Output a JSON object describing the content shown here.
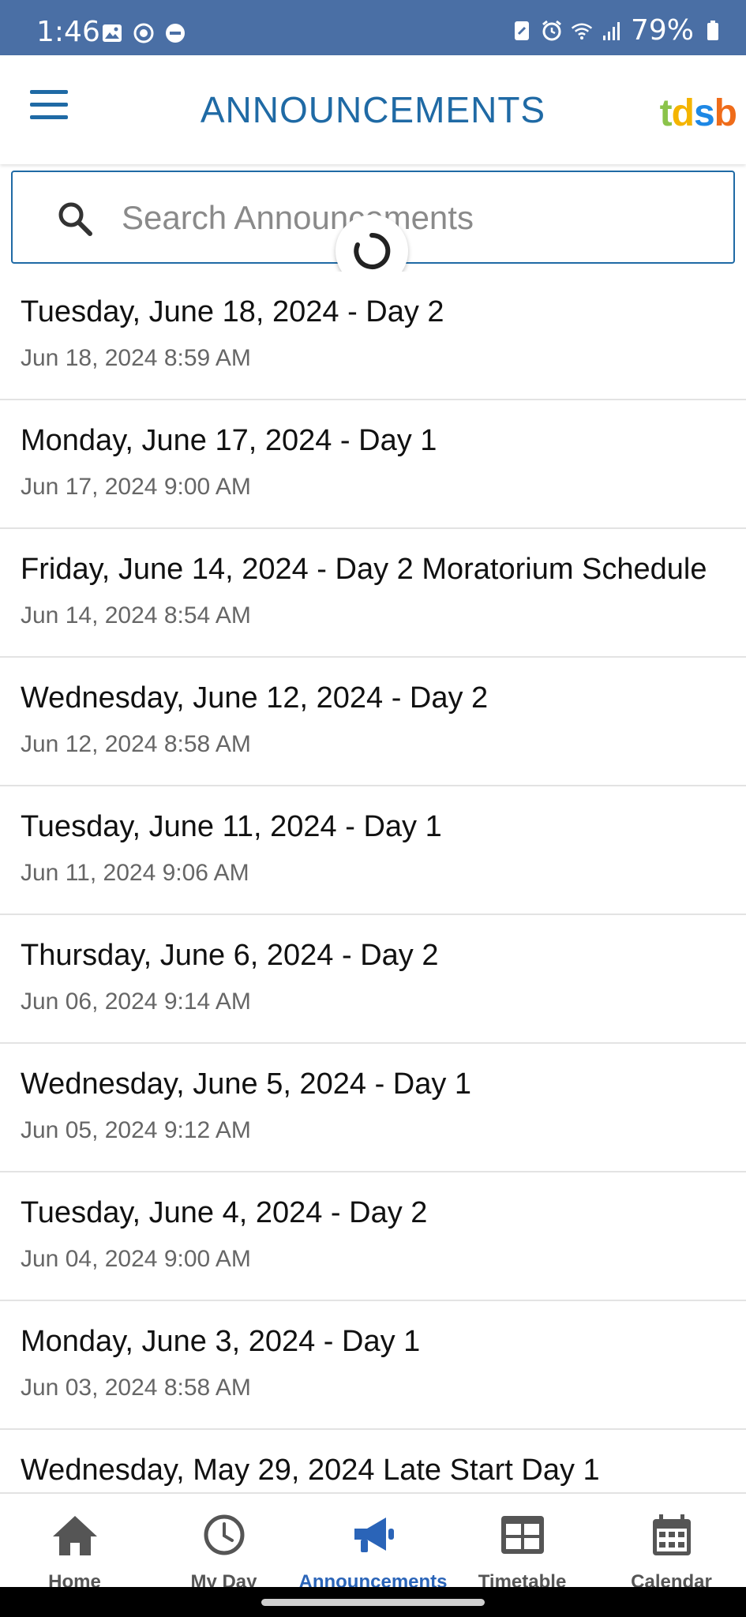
{
  "status_bar": {
    "time": "1:46",
    "battery": "79%",
    "left_icons": [
      "image-icon",
      "sync-icon",
      "do-not-disturb-icon"
    ],
    "right_icons": [
      "nfc-icon",
      "alarm-icon",
      "wifi-icon",
      "signal-icon",
      "battery-icon"
    ]
  },
  "header": {
    "title": "ANNOUNCEMENTS",
    "logo": {
      "t": "t",
      "d": "d",
      "s": "s",
      "b": "b"
    },
    "title_color": "#1f6aa5"
  },
  "search": {
    "placeholder": "Search Announcements",
    "value": ""
  },
  "announcements": [
    {
      "title": "Tuesday, June 18, 2024 - Day 2",
      "date": "Jun 18, 2024 8:59 AM"
    },
    {
      "title": "Monday, June 17, 2024 - Day 1",
      "date": "Jun 17, 2024 9:00 AM"
    },
    {
      "title": "Friday, June 14, 2024 - Day 2 Moratorium Schedule",
      "date": "Jun 14, 2024 8:54 AM"
    },
    {
      "title": "Wednesday, June 12, 2024 - Day 2",
      "date": "Jun 12, 2024 8:58 AM"
    },
    {
      "title": "Tuesday, June 11, 2024 - Day 1",
      "date": "Jun 11, 2024 9:06 AM"
    },
    {
      "title": "Thursday, June 6, 2024 - Day 2",
      "date": "Jun 06, 2024 9:14 AM"
    },
    {
      "title": "Wednesday, June 5, 2024 - Day 1",
      "date": "Jun 05, 2024 9:12 AM"
    },
    {
      "title": "Tuesday, June 4, 2024 - Day 2",
      "date": "Jun 04, 2024 9:00 AM"
    },
    {
      "title": "Monday, June 3, 2024 - Day 1",
      "date": "Jun 03, 2024 8:58 AM"
    },
    {
      "title": "Wednesday, May 29, 2024 Late Start Day 1",
      "date": ""
    }
  ],
  "bottom_nav": [
    {
      "label": "Home",
      "icon": "home-icon",
      "active": false
    },
    {
      "label": "My Day",
      "icon": "clock-icon",
      "active": false
    },
    {
      "label": "Announcements",
      "icon": "megaphone-icon",
      "active": true
    },
    {
      "label": "Timetable",
      "icon": "timetable-icon",
      "active": false
    },
    {
      "label": "Calendar",
      "icon": "calendar-icon",
      "active": false
    }
  ],
  "colors": {
    "status_bar": "#4a6fa5",
    "accent": "#1f6aa5",
    "nav_active": "#2a64b8",
    "nav_inactive": "#555555"
  }
}
